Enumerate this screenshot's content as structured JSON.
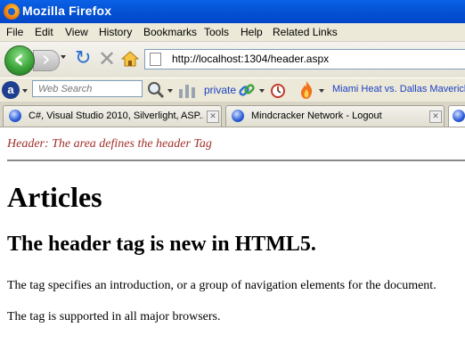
{
  "window": {
    "title": "Mozilla Firefox"
  },
  "menu": [
    "File",
    "Edit",
    "View",
    "History",
    "Bookmarks",
    "Tools",
    "Help",
    "Related Links"
  ],
  "nav": {
    "url": "http://localhost:1304/header.aspx"
  },
  "toolbar2": {
    "search_placeholder": "Web Search",
    "private_label": "private",
    "news_link": "Miami Heat vs. Dallas Mavericks"
  },
  "tabs": [
    {
      "label": "C#, Visual Studio 2010, Silverlight, ASP...",
      "active": false
    },
    {
      "label": "Mindcracker Network - Logout",
      "active": false
    },
    {
      "label": "",
      "active": true
    }
  ],
  "content": {
    "header_note": "Header: The area defines the header Tag",
    "h1": "Articles",
    "h2": "The header tag is new in HTML5.",
    "p1": "The tag specifies an introduction, or a group of navigation elements for the document.",
    "p2": "The tag is supported in all major browsers."
  },
  "colors": {
    "titlebar": "#0553d6",
    "header_note": "#a0302a",
    "link": "#1a3ec6"
  }
}
